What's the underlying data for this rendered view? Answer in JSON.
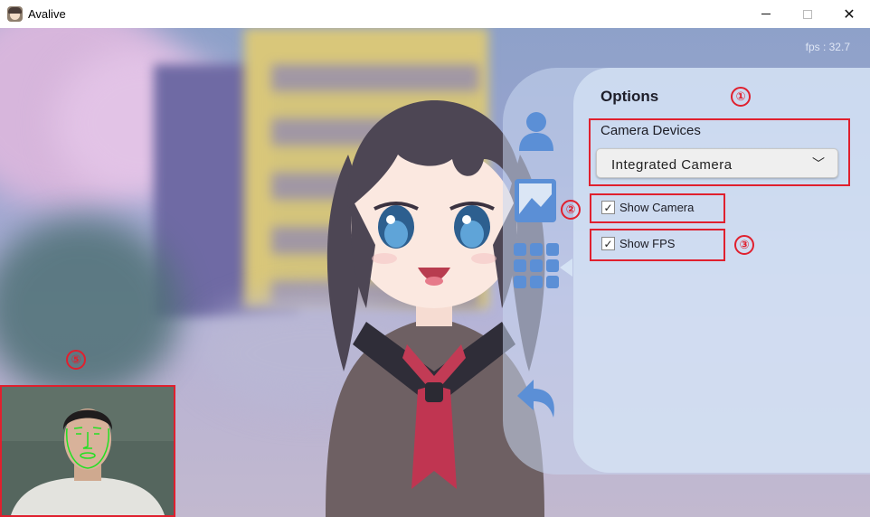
{
  "window": {
    "title": "Avalive",
    "controls": {
      "minimize": "—",
      "maximize": "☐",
      "close": "✕"
    }
  },
  "overlay": {
    "fps_text": "fps : 32.7"
  },
  "options": {
    "title": "Options",
    "camera_devices_label": "Camera Devices",
    "camera_device_selected": "Integrated Camera",
    "show_camera": {
      "label": "Show Camera",
      "checked": true
    },
    "show_fps": {
      "label": "Show FPS",
      "checked": true
    }
  },
  "sidebar": {
    "icons": [
      "avatar-icon",
      "background-image-icon",
      "grid-icon",
      "back-arrow-icon"
    ]
  },
  "annotations": [
    "①",
    "②",
    "③",
    "⑤"
  ],
  "colors": {
    "annotation": "#e0202e",
    "panel": "#d7e4f5",
    "icon": "#5b8fd6",
    "face_mesh": "#22e022"
  }
}
